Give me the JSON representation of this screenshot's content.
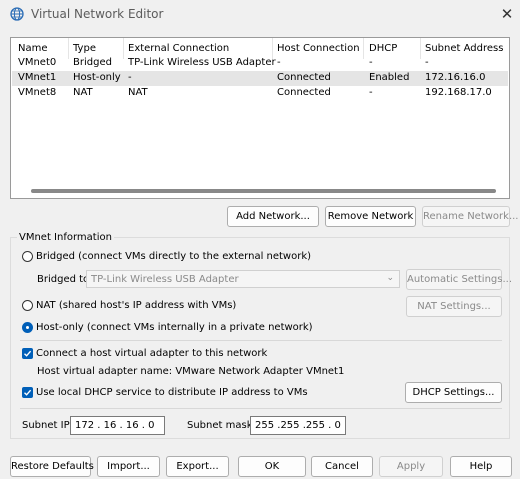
{
  "window": {
    "title": "Virtual Network Editor",
    "close": "✕"
  },
  "table": {
    "columns": [
      "Name",
      "Type",
      "External Connection",
      "Host Connection",
      "DHCP",
      "Subnet Address"
    ],
    "rows": [
      [
        "VMnet0",
        "Bridged",
        "TP-Link Wireless USB Adapter",
        "-",
        "-",
        "-"
      ],
      [
        "VMnet1",
        "Host-only",
        "-",
        "Connected",
        "Enabled",
        "172.16.16.0"
      ],
      [
        "VMnet8",
        "NAT",
        "NAT",
        "Connected",
        "-",
        "192.168.17.0"
      ]
    ],
    "selected_row": 1
  },
  "net_buttons": {
    "add": "Add Network...",
    "remove": "Remove Network",
    "rename": "Rename Network..."
  },
  "vmnet_info": {
    "label": "VMnet Information",
    "bridged": "Bridged (connect VMs directly to the external network)",
    "bridged_to_label": "Bridged to:",
    "bridged_to_value": "TP-Link Wireless USB Adapter",
    "auto_settings": "Automatic Settings...",
    "nat": "NAT (shared host's IP address with VMs)",
    "nat_settings": "NAT Settings...",
    "host_only": "Host-only (connect VMs internally in a private network)",
    "selected_mode": "host-only",
    "connect_adapter": "Connect a host virtual adapter to this network",
    "connect_adapter_checked": true,
    "adapter_name": "Host virtual adapter name: VMware Network Adapter VMnet1",
    "use_dhcp": "Use local DHCP service to distribute IP address to VMs",
    "use_dhcp_checked": true,
    "dhcp_settings": "DHCP Settings...",
    "subnet_ip_label": "Subnet IP:",
    "subnet_ip": "172 . 16 . 16 . 0",
    "subnet_mask_label": "Subnet mask:",
    "subnet_mask": "255 .255 .255 . 0"
  },
  "bottom_buttons": {
    "restore": "Restore Defaults",
    "import": "Import...",
    "export": "Export...",
    "ok": "OK",
    "cancel": "Cancel",
    "apply": "Apply",
    "help": "Help"
  },
  "colors": {
    "accent": "#005fb8",
    "selected_row": "#e5e5e5",
    "disabled_text": "#8a8a8a"
  }
}
